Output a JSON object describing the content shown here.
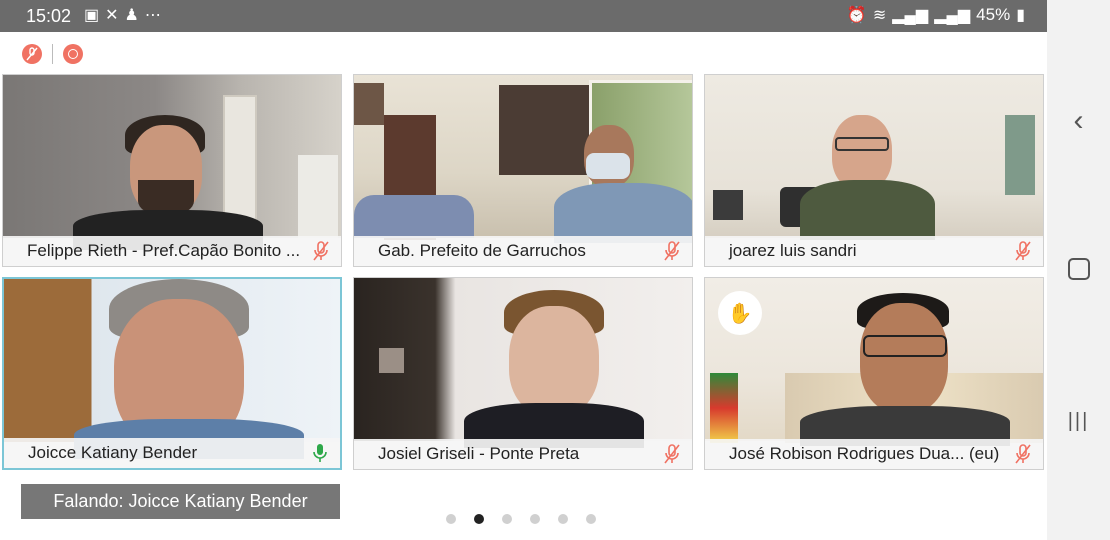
{
  "status_bar": {
    "time": "15:02",
    "battery": "45%",
    "left_icons": [
      "image-icon",
      "missed-call-icon",
      "person-icon",
      "more-icon"
    ],
    "right_icons": [
      "alarm-icon",
      "wifi-icon",
      "signal-icon",
      "signal-icon",
      "battery-icon"
    ]
  },
  "toolbar": {
    "icons": [
      "mic-muted-icon",
      "record-icon"
    ]
  },
  "tiles": [
    {
      "name": "Felippe Rieth - Pref.Capão Bonito ...",
      "mic": "muted"
    },
    {
      "name": "Gab. Prefeito de Garruchos",
      "mic": "muted"
    },
    {
      "name": "joarez luis sandri",
      "mic": "muted"
    },
    {
      "name": "Joicce Katiany Bender",
      "mic": "active"
    },
    {
      "name": "Josiel Griseli - Ponte Preta",
      "mic": "muted"
    },
    {
      "name": "José Robison Rodrigues Dua... (eu)",
      "mic": "muted",
      "hand_raised": true
    }
  ],
  "speaking_label": "Falando: Joicce Katiany Bender",
  "pager": {
    "total": 6,
    "current": 2
  },
  "colors": {
    "muted_mic": "#f07263",
    "active_mic": "#2ea84a",
    "active_border": "#7cc6d6"
  }
}
